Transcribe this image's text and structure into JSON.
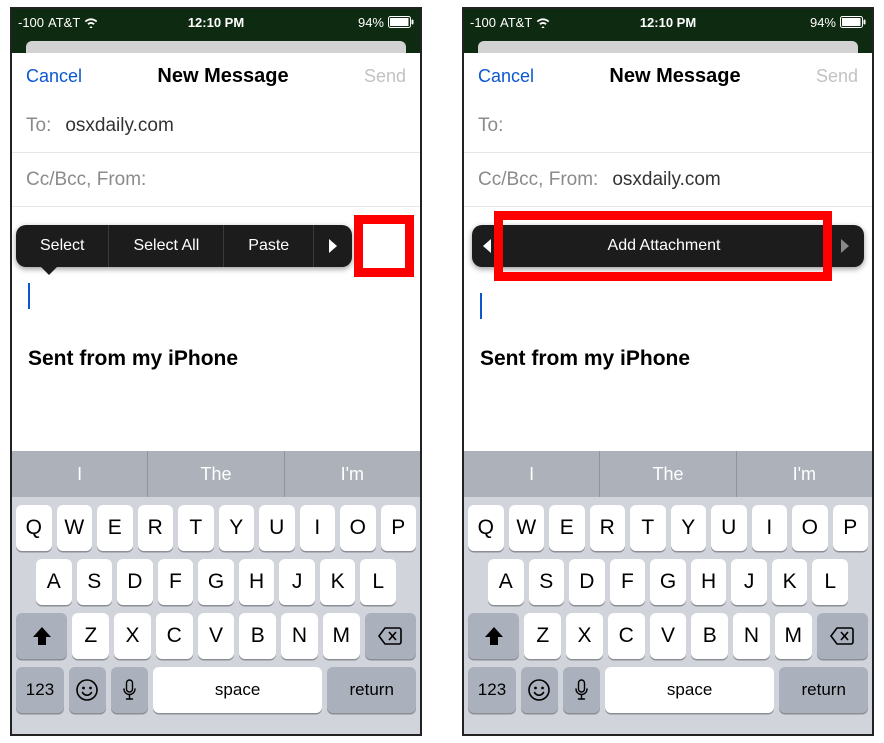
{
  "status": {
    "signal": "-100",
    "carrier": "AT&T",
    "time": "12:10 PM",
    "battery_pct": "94%"
  },
  "nav": {
    "cancel": "Cancel",
    "title": "New Message",
    "send": "Send"
  },
  "fields": {
    "to_label": "To:",
    "ccbcc_label": "Cc/Bcc, From:",
    "recipient": "osxdaily.com"
  },
  "body": {
    "signature": "Sent from my iPhone"
  },
  "popover1": {
    "select": "Select",
    "select_all": "Select All",
    "paste": "Paste"
  },
  "popover2": {
    "add_attachment": "Add Attachment"
  },
  "keyboard": {
    "predictions": [
      "I",
      "The",
      "I'm"
    ],
    "row1": [
      "Q",
      "W",
      "E",
      "R",
      "T",
      "Y",
      "U",
      "I",
      "O",
      "P"
    ],
    "row2": [
      "A",
      "S",
      "D",
      "F",
      "G",
      "H",
      "J",
      "K",
      "L"
    ],
    "row3": [
      "Z",
      "X",
      "C",
      "V",
      "B",
      "N",
      "M"
    ],
    "k123": "123",
    "space": "space",
    "return": "return"
  }
}
